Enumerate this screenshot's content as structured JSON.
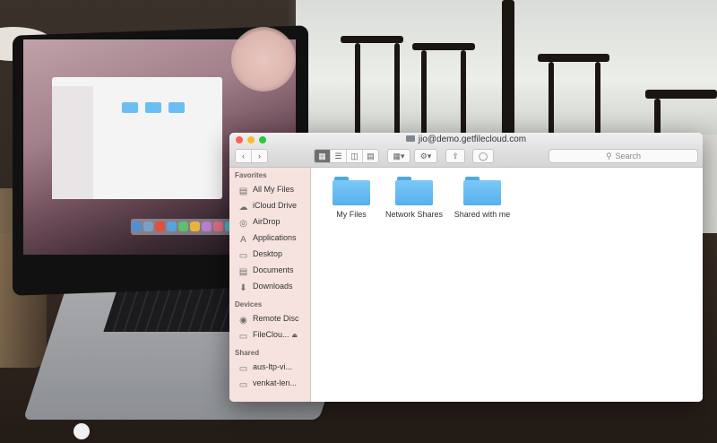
{
  "window": {
    "title": "jio@demo.getfilecloud.com"
  },
  "toolbar": {
    "back_icon": "chevron-left",
    "forward_icon": "chevron-right",
    "view_icons": [
      "icon-view",
      "list-view",
      "column-view",
      "cover-flow-view"
    ],
    "arrange_icon": "arrange",
    "action_icon": "gear",
    "share_icon": "share",
    "tags_icon": "tag",
    "search_placeholder": "Search"
  },
  "sidebar": {
    "sections": [
      {
        "title": "Favorites",
        "items": [
          {
            "label": "All My Files",
            "icon": "all-files"
          },
          {
            "label": "iCloud Drive",
            "icon": "cloud"
          },
          {
            "label": "AirDrop",
            "icon": "airdrop"
          },
          {
            "label": "Applications",
            "icon": "applications"
          },
          {
            "label": "Desktop",
            "icon": "desktop"
          },
          {
            "label": "Documents",
            "icon": "documents"
          },
          {
            "label": "Downloads",
            "icon": "downloads"
          }
        ]
      },
      {
        "title": "Devices",
        "items": [
          {
            "label": "Remote Disc",
            "icon": "disc"
          },
          {
            "label": "FileClou...",
            "icon": "drive"
          }
        ]
      },
      {
        "title": "Shared",
        "items": [
          {
            "label": "aus-ltp-vi...",
            "icon": "computer"
          },
          {
            "label": "venkat-len...",
            "icon": "computer"
          }
        ]
      }
    ]
  },
  "folders": [
    {
      "label": "My Files"
    },
    {
      "label": "Network Shares"
    },
    {
      "label": "Shared with me"
    }
  ],
  "colors": {
    "folder": "#6cbdf3",
    "sidebar": "#f3e0dd",
    "close": "#fd5f57",
    "minimize": "#febc2e",
    "maximize": "#28c840"
  }
}
